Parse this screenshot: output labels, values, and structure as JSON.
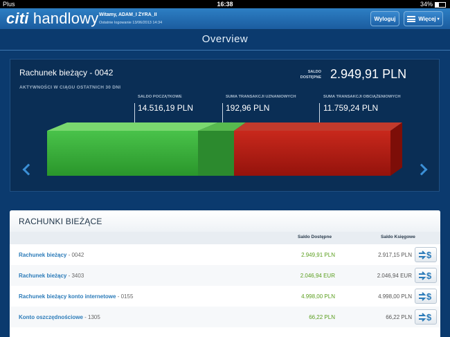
{
  "status_bar": {
    "carrier": "Plus",
    "time": "16:38",
    "battery": "34%"
  },
  "app_bar": {
    "logo_brand": "citi",
    "logo_product": "handlowy",
    "welcome": "Witamy, ADAM_I ŻYRA_II",
    "last_login": "Ostatnie logowanie 13/06/2013 14:34",
    "logout_label": "Wyloguj",
    "more_label": "Więcej"
  },
  "page_title": "Overview",
  "summary": {
    "account_title": "Rachunek bieżący - 0042",
    "activity_label": "AKTYWNOŚCI W CIĄGU OSTATNICH 30 DNI",
    "saldo_label_line1": "SALDO",
    "saldo_label_line2": "DOSTĘPNE",
    "saldo_value": "2.949,91 PLN",
    "opening_label": "SALDO POCZĄTKOWE",
    "opening_value": "14.516,19 PLN",
    "credits_label": "SUMA TRANSAKCJI UZNANIOWYCH",
    "credits_value": "192,96 PLN",
    "debits_label": "SUMA TRANSAKCJI OBCIĄŻENIOWYCH",
    "debits_value": "11.759,24 PLN",
    "colors": {
      "green": "#2fa82f",
      "red": "#b31a12"
    }
  },
  "accounts": {
    "section_title": "RACHUNKI BIEŻĄCE",
    "col_available": "Saldo Dostępne",
    "col_booked": "Saldo Księgowe",
    "rows": [
      {
        "name": "Rachunek bieżący",
        "suffix": " - 0042",
        "available": "2.949,91 PLN",
        "booked": "2.917,15 PLN"
      },
      {
        "name": "Rachunek bieżący",
        "suffix": " - 3403",
        "available": "2.046,94 EUR",
        "booked": "2.046,94 EUR"
      },
      {
        "name": "Rachunek bieżący konto internetowe",
        "suffix": " - 0155",
        "available": "4.998,00 PLN",
        "booked": "4.998,00 PLN"
      },
      {
        "name": "Konto oszczędnościowe",
        "suffix": " - 1305",
        "available": "66,22 PLN",
        "booked": "66,22 PLN"
      }
    ]
  }
}
